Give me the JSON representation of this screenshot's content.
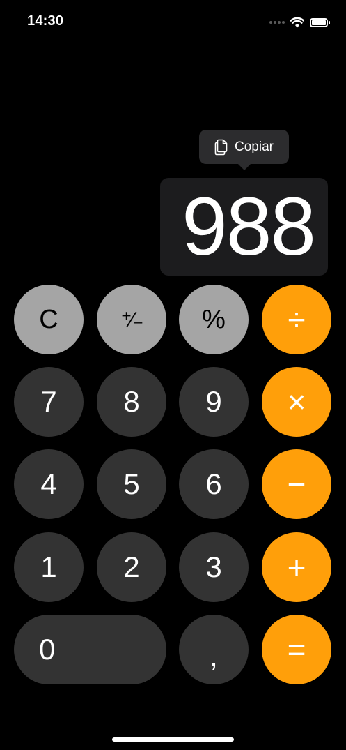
{
  "status_bar": {
    "time": "14:30"
  },
  "copy_tooltip": {
    "label": "Copiar",
    "icon": "copy-icon"
  },
  "display": {
    "value": "988"
  },
  "keys": {
    "clear": "C",
    "plus_minus": "⁺∕₋",
    "percent": "%",
    "divide": "÷",
    "seven": "7",
    "eight": "8",
    "nine": "9",
    "multiply": "×",
    "four": "4",
    "five": "5",
    "six": "6",
    "minus": "−",
    "one": "1",
    "two": "2",
    "three": "3",
    "plus": "+",
    "zero": "0",
    "decimal": ",",
    "equals": "="
  },
  "colors": {
    "background": "#000000",
    "function_key": "#a5a5a5",
    "number_key": "#333333",
    "operator_key": "#ff9f0a",
    "display_highlight": "#1c1c1e",
    "tooltip": "#2c2c2e"
  }
}
